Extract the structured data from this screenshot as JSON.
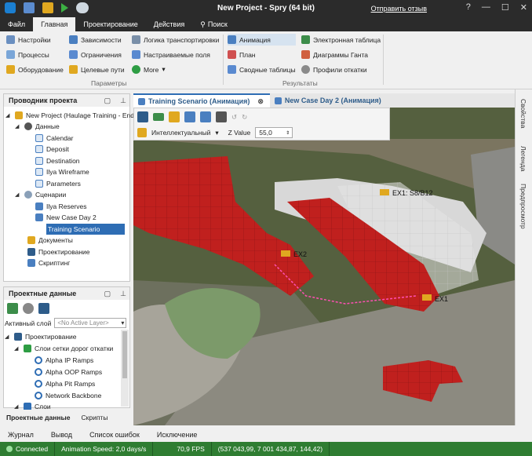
{
  "window": {
    "title": "New Project - Spry (64 bit)",
    "feedback_link": "Отправить отзыв"
  },
  "menu": {
    "tabs": [
      "Файл",
      "Главная",
      "Проектирование",
      "Действия",
      "Поиск"
    ],
    "active": "Главная"
  },
  "ribbon": {
    "col1": [
      "Настройки",
      "Процессы",
      "Оборудование"
    ],
    "col2": [
      "Зависимости",
      "Ограничения",
      "Целевые пути"
    ],
    "col3": [
      "Логика транспортировки",
      "Настраиваемые поля",
      "More"
    ],
    "col4": [
      "Анимация",
      "План",
      "Сводные таблицы"
    ],
    "col5": [
      "Электронная таблица",
      "Диаграммы Ганта",
      "Профили откатки"
    ],
    "group_params": "Параметры",
    "group_results": "Результаты"
  },
  "explorer": {
    "title": "Проводник проекта",
    "project": "New Project (Haulage Training - End c",
    "data_folder": "Данные",
    "data_items": [
      "Calendar",
      "Deposit",
      "Destination",
      "Ilya Wireframe",
      "Parameters"
    ],
    "scenarios_folder": "Сценарии",
    "scenario_items": [
      "Ilya Reserves",
      "New Case Day 2",
      "Training Scenario"
    ],
    "other_items": [
      "Документы",
      "Проектирование",
      "Скриптинг"
    ]
  },
  "project_data": {
    "title": "Проектные данные",
    "active_layer_label": "Активный слой",
    "active_layer_value": "<No Active Layer>",
    "tree_root": "Проектирование",
    "layer_group": "Слои сетки дорог откатки",
    "layers": [
      "Alpha IP Ramps",
      "Alpha OOP Ramps",
      "Alpha Pit Ramps",
      "Network Backbone"
    ],
    "layer_more": "Слои"
  },
  "left_bottom_tabs": [
    "Проектные данные",
    "Скрипты"
  ],
  "doc_tabs": [
    "Training Scenario (Анимация)",
    "New Case Day 2 (Анимация)"
  ],
  "view_toolbar": {
    "mode": "Интеллектуальный",
    "z_label": "Z Value",
    "z_value": "55,0"
  },
  "scene_labels": [
    "EX1: S8/B12",
    "EX2",
    "EX1"
  ],
  "right_tabs": [
    "Свойства",
    "Легенда",
    "Предпросмотр"
  ],
  "output_tabs": [
    "Журнал",
    "Вывод",
    "Список ошибок",
    "Исключение"
  ],
  "status": {
    "connected": "Connected",
    "speed": "Animation Speed: 2,0 days/s",
    "fps": "70,9 FPS",
    "coords": "(537 043,99, 7 001 434,87, 144,42)"
  },
  "colors": {
    "accent": "#2e6db4",
    "status_bar": "#2f7d32",
    "block_red": "#c0201e",
    "titlebar": "#2b2b2b"
  }
}
